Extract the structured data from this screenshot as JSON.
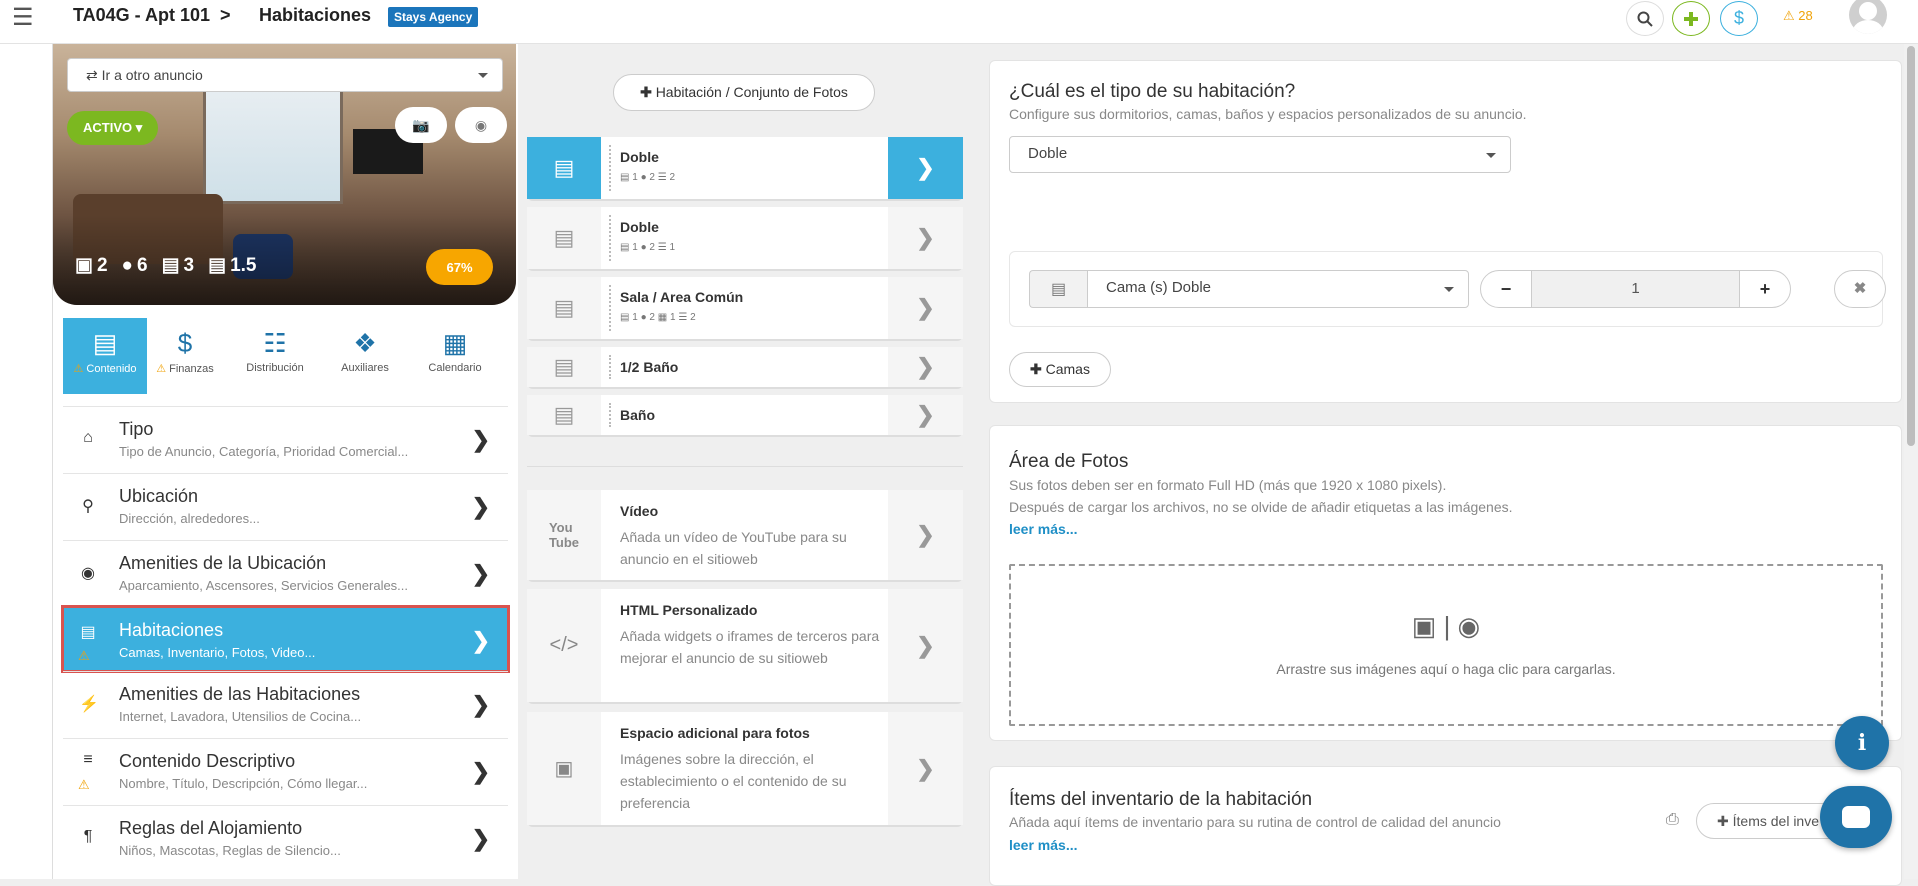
{
  "header": {
    "listing": "TA04G - Apt 101",
    "separator": ">",
    "section": "Habitaciones",
    "agency_badge": "Stays Agency",
    "alerts_count": "28"
  },
  "left": {
    "goto_placeholder": "Ir a otro anuncio",
    "status": "ACTIVO",
    "stats": {
      "rooms": "2",
      "guests": "6",
      "beds": "3",
      "baths": "1.5"
    },
    "completion": "67%",
    "tabs": [
      {
        "label": "Contenido"
      },
      {
        "label": "Finanzas"
      },
      {
        "label": "Distribución"
      },
      {
        "label": "Auxiliares"
      },
      {
        "label": "Calendario"
      }
    ],
    "menu": [
      {
        "title": "Tipo",
        "subtitle": "Tipo de Anuncio, Categoría, Prioridad Comercial..."
      },
      {
        "title": "Ubicación",
        "subtitle": "Dirección, alrededores..."
      },
      {
        "title": "Amenities de la Ubicación",
        "subtitle": "Aparcamiento, Ascensores, Servicios Generales..."
      },
      {
        "title": "Habitaciones",
        "subtitle": "Camas, Inventario, Fotos, Video..."
      },
      {
        "title": "Amenities de las Habitaciones",
        "subtitle": "Internet, Lavadora, Utensilios de Cocina..."
      },
      {
        "title": "Contenido Descriptivo",
        "subtitle": "Nombre, Título, Descripción, Cómo llegar..."
      },
      {
        "title": "Reglas del Alojamiento",
        "subtitle": "Niños, Mascotas, Reglas de Silencio..."
      }
    ]
  },
  "middle": {
    "add_room_button": "Habitación / Conjunto de Fotos",
    "rooms": [
      {
        "name": "Doble",
        "meta": [
          "1",
          "2",
          "2"
        ]
      },
      {
        "name": "Doble",
        "meta": [
          "1",
          "2",
          "1"
        ]
      },
      {
        "name": "Sala / Area Común",
        "meta": [
          "1",
          "2",
          "1",
          "2"
        ]
      },
      {
        "name": "1/2 Baño"
      },
      {
        "name": "Baño"
      }
    ],
    "extras": [
      {
        "title": "Vídeo",
        "desc": "Añada un vídeo de YouTube para su anuncio en el sitioweb"
      },
      {
        "title": "HTML Personalizado",
        "desc": "Añada widgets o iframes de terceros para mejorar el anuncio de su sitioweb"
      },
      {
        "title": "Espacio adicional para fotos",
        "desc": "Imágenes sobre la dirección, el establecimiento o el contenido de su preferencia"
      }
    ]
  },
  "right": {
    "room_type": {
      "title": "¿Cuál es el tipo de su habitación?",
      "subtitle": "Configure sus dormitorios, camas, baños y espacios personalizados de su anuncio.",
      "selected": "Doble"
    },
    "bed": {
      "type": "Cama (s) Doble",
      "quantity": "1"
    },
    "add_beds_button": "Camas",
    "photos": {
      "title": "Área de Fotos",
      "line1": "Sus fotos deben ser en formato Full HD (más que 1920 x 1080 pixels).",
      "line2": "Después de cargar los archivos, no se olvide de añadir etiquetas a las imágenes.",
      "more": "leer más...",
      "drop_text": "Arrastre sus imágenes aquí o haga clic para cargarlas."
    },
    "inventory": {
      "title": "Ítems del inventario de la habitación",
      "subtitle": "Añada aquí ítems de inventario para su rutina de control de calidad del anuncio",
      "more": "leer más...",
      "button": "Ítems del inve"
    }
  },
  "colors": {
    "accent": "#3cb0de",
    "brand": "#1f73a8",
    "warning": "#f0a30a",
    "active_status": "#7cb820"
  }
}
